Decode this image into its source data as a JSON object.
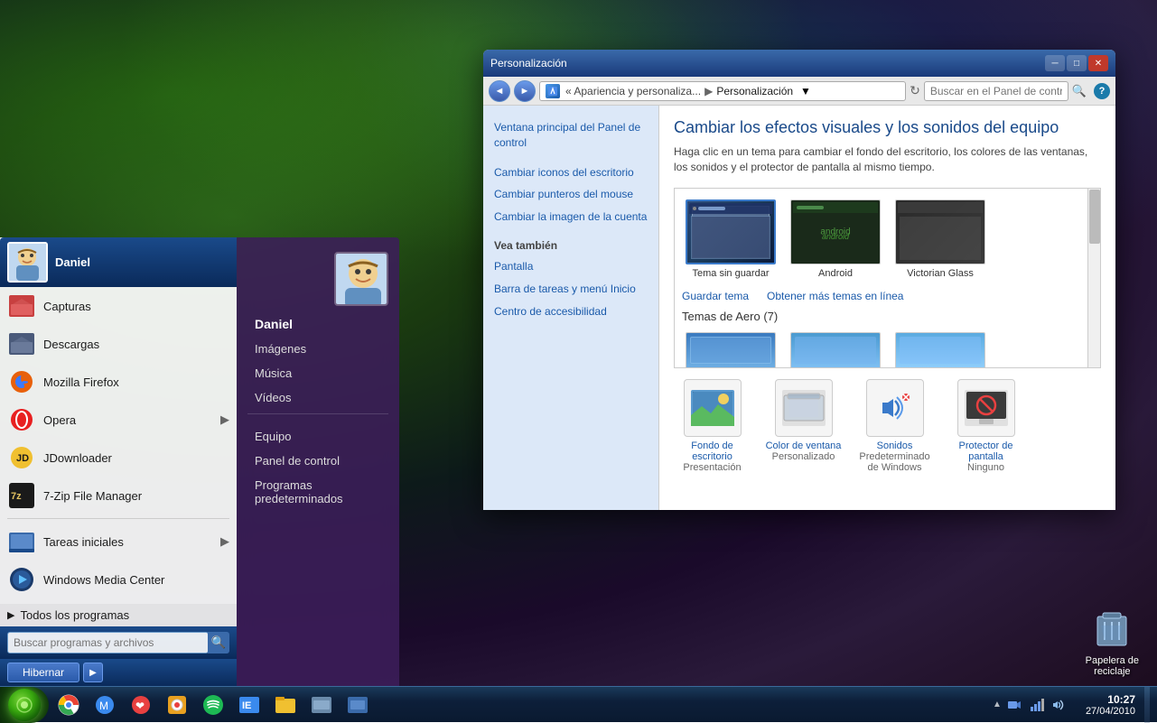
{
  "desktop": {
    "recycle_bin_label": "Papelera de\nreciclaje"
  },
  "taskbar": {
    "time": "10:27",
    "date": "27/04/2010"
  },
  "start_menu": {
    "user_name": "Daniel",
    "pinned_items": [
      {
        "label": "Capturas",
        "icon": "folder-red"
      },
      {
        "label": "Descargas",
        "icon": "folder-dark"
      },
      {
        "label": "Mozilla Firefox",
        "icon": "firefox"
      },
      {
        "label": "Opera",
        "icon": "opera",
        "arrow": true
      },
      {
        "label": "JDownloader",
        "icon": "jdownloader"
      },
      {
        "label": "7-Zip File Manager",
        "icon": "7zip"
      },
      {
        "label": "Tareas iniciales",
        "icon": "taskbar",
        "arrow": true
      },
      {
        "label": "Windows Media Center",
        "icon": "wmc"
      }
    ],
    "all_programs": "Todos los programas",
    "search_placeholder": "Buscar programas y archivos",
    "hibernate_label": "Hibernar",
    "right_items": [
      "Imágenes",
      "Música",
      "Vídeos",
      "Equipo",
      "Panel de control",
      "Programas predeterminados"
    ]
  },
  "control_panel": {
    "title": "Personalización",
    "breadcrumb": [
      {
        "label": "« Apariencia y personaliza..."
      },
      {
        "label": "Personalización"
      }
    ],
    "search_placeholder": "Buscar en el Panel de control",
    "sidebar": {
      "main_link": "Ventana principal del Panel de control",
      "links": [
        "Cambiar iconos del escritorio",
        "Cambiar punteros del mouse",
        "Cambiar la imagen de la cuenta"
      ],
      "see_also_label": "Vea también",
      "see_also_links": [
        "Pantalla",
        "Barra de tareas y menú Inicio",
        "Centro de accesibilidad"
      ]
    },
    "main": {
      "title": "Cambiar los efectos visuales y los sonidos del equipo",
      "subtitle": "Haga clic en un tema para cambiar el fondo del escritorio, los colores de las ventanas, los sonidos y el protector de pantalla al mismo tiempo.",
      "themes": [
        {
          "label": "Tema sin guardar",
          "selected": true,
          "type": "unsaved"
        },
        {
          "label": "Android",
          "selected": false,
          "type": "android"
        },
        {
          "label": "Victorian Glass",
          "selected": false,
          "type": "victorian"
        }
      ],
      "save_theme_link": "Guardar tema",
      "get_themes_link": "Obtener más temas en línea",
      "aero_section_label": "Temas de Aero (7)",
      "bottom_icons": [
        {
          "label": "Fondo de escritorio",
          "sublabel": "Presentación",
          "type": "wallpaper"
        },
        {
          "label": "Color de ventana",
          "sublabel": "Personalizado",
          "type": "color"
        },
        {
          "label": "Sonidos",
          "sublabel": "Predeterminado de Windows",
          "type": "sounds"
        },
        {
          "label": "Protector de pantalla",
          "sublabel": "Ninguno",
          "type": "screensaver"
        }
      ]
    }
  }
}
